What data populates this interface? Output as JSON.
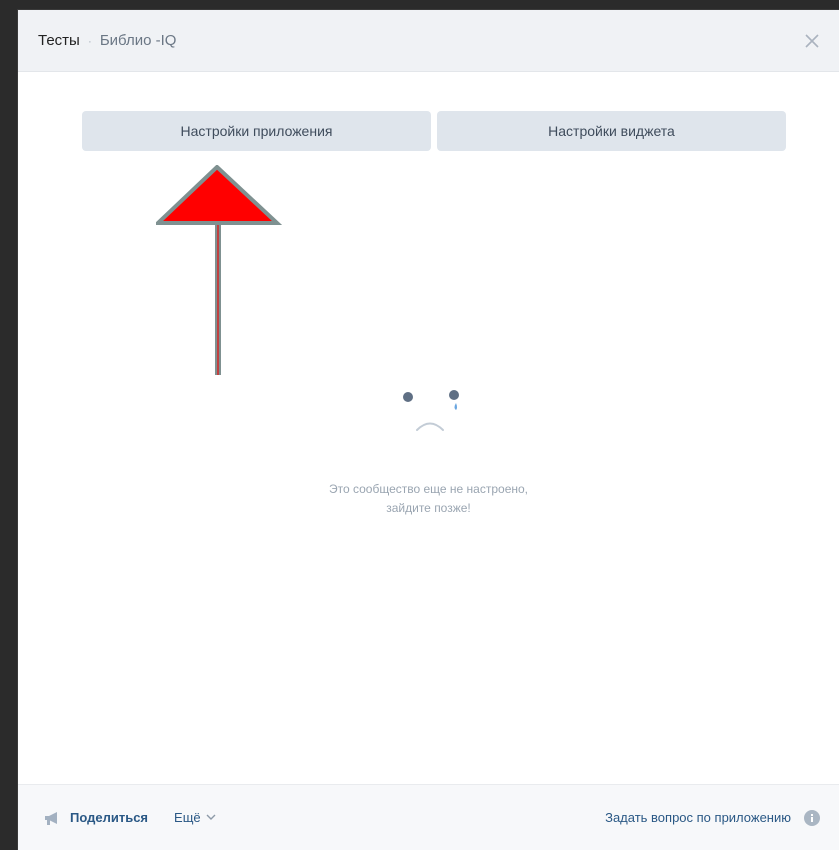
{
  "header": {
    "title": "Тесты",
    "separator": "·",
    "subtitle": "Библио -IQ",
    "close_icon": "close-icon"
  },
  "tabs": [
    {
      "label": "Настройки приложения"
    },
    {
      "label": "Настройки виджета"
    }
  ],
  "annotation": {
    "icon": "up-arrow-annotation",
    "fill_color": "#ff0000",
    "stroke_color": "#7f9191"
  },
  "empty_state": {
    "icon": "sad-face-icon",
    "line1": "Это сообщество еще не настроено,",
    "line2": "зайдите позже!"
  },
  "footer": {
    "share_label": "Поделиться",
    "share_icon": "megaphone-icon",
    "more_label": "Ещё",
    "more_icon": "chevron-down-icon",
    "ask_label": "Задать вопрос по приложению",
    "ask_icon": "info-icon"
  },
  "colors": {
    "link": "#2a5885",
    "tab_bg": "#dfe5ec",
    "header_bg": "#f0f2f5"
  }
}
